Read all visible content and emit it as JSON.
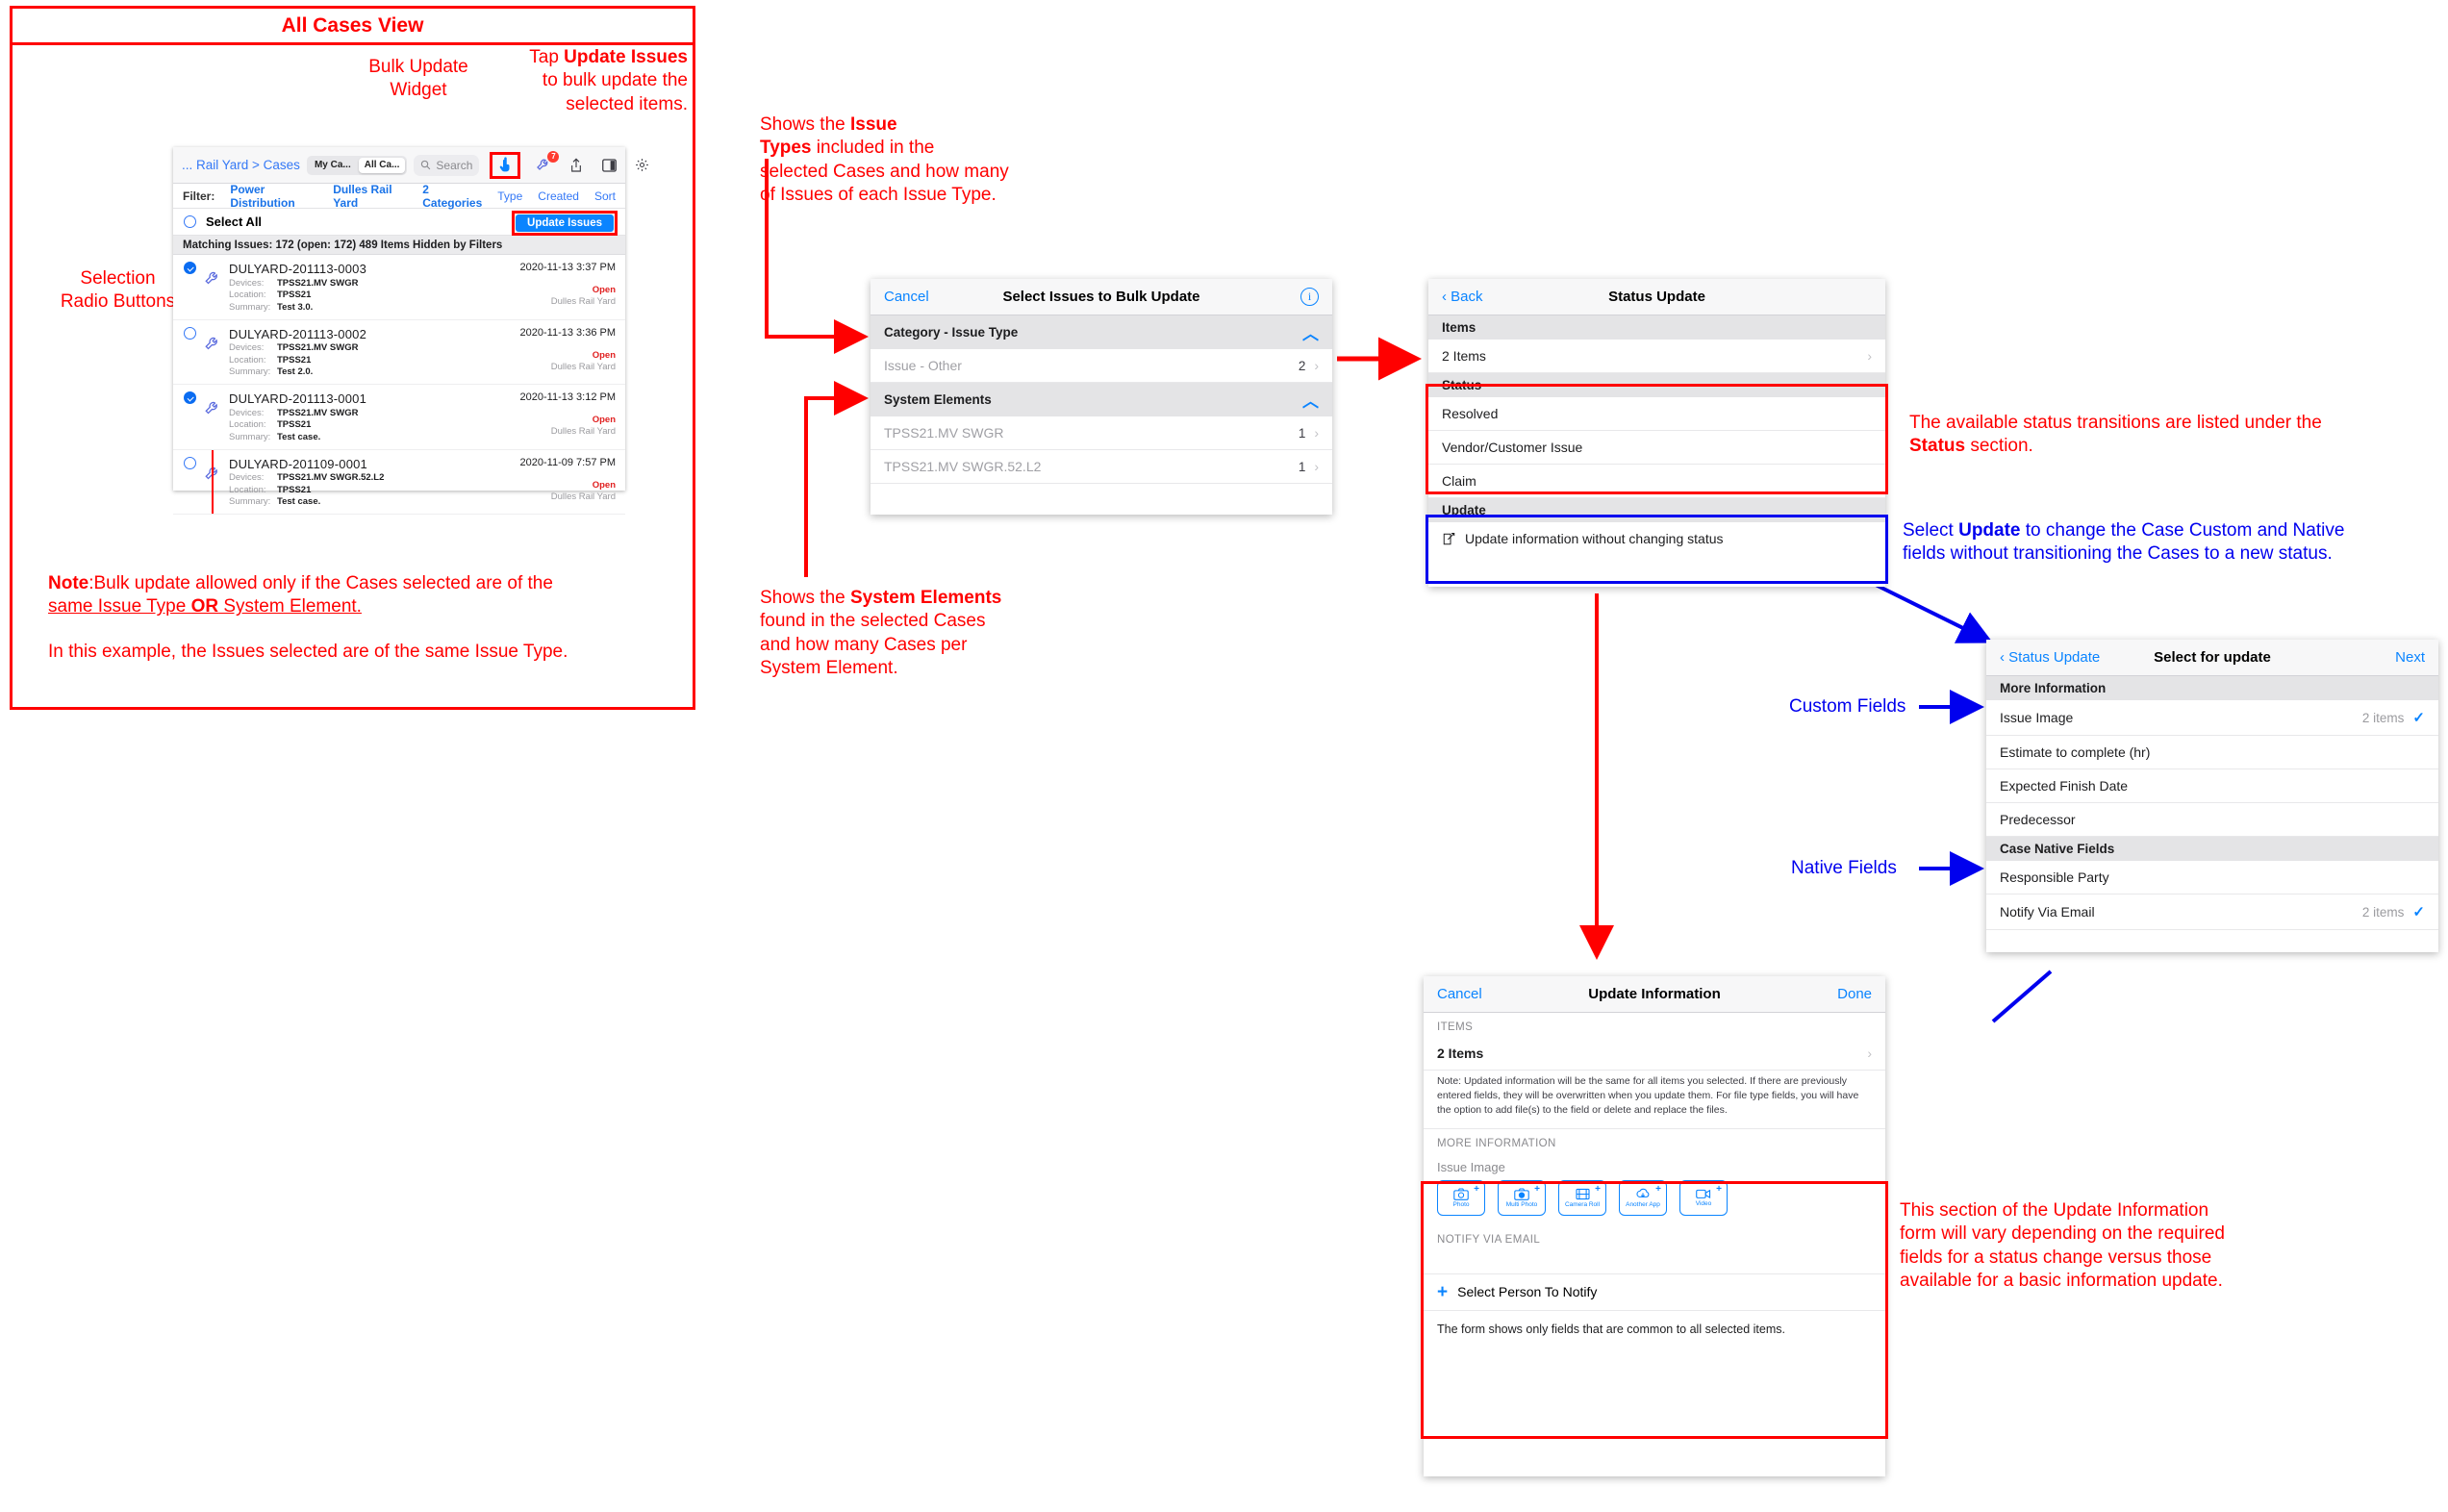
{
  "frame": {
    "title": "All Cases View"
  },
  "annotations": {
    "bulk_update_widget": "Bulk Update\nWidget",
    "tap_update_issues_l1": "Tap ",
    "tap_update_issues_b": "Update Issues",
    "tap_update_issues_l2": "to bulk update the",
    "tap_update_issues_l3": "selected items.",
    "selection_radio": "Selection\nRadio Buttons",
    "note_label": "Note",
    "note_line1": ":Bulk update allowed only if the Cases selected are of the",
    "note_line2a": "same Issue Type ",
    "note_line2b": "OR",
    "note_line2c": " System Element.",
    "note_line3": "In this example, the Issues selected are of the same Issue Type.",
    "issue_types_a": "Shows the ",
    "issue_types_b": "Issue",
    "issue_types_c": "Types",
    "issue_types_d": " included in the",
    "issue_types_e": "selected Cases and how many",
    "issue_types_f": "of Issues of each Issue Type.",
    "system_elements_a": "Shows the ",
    "system_elements_b": "System Elements",
    "system_elements_c": " found in the selected Cases",
    "system_elements_d": "and how many Cases per",
    "system_elements_e": "System Element.",
    "status_transitions_a": "The available status transitions are listed under the",
    "status_transitions_b": "Status",
    "status_transitions_c": " section.",
    "update_select_a": "Select ",
    "update_select_b": "Update",
    "update_select_c": " to change the Case Custom and Native",
    "update_select_d": "fields without transitioning the Cases to a new status.",
    "custom_fields": "Custom Fields",
    "native_fields": "Native Fields",
    "update_info_note_1": "This section of the Update Information",
    "update_info_note_2": "form will vary depending on the required",
    "update_info_note_3": "fields for a status change versus those",
    "update_info_note_4": "available for a basic information update."
  },
  "cases_list": {
    "breadcrumb": "... Rail Yard > Cases",
    "segments": [
      {
        "label": "My Ca...",
        "selected": false
      },
      {
        "label": "All Ca...",
        "selected": true
      }
    ],
    "search_placeholder": "Search",
    "search_icon": "search-icon",
    "toolbar_icons": [
      {
        "name": "bulk-update-hand-icon",
        "badge": ""
      },
      {
        "name": "wrench-icon",
        "badge": "7"
      },
      {
        "name": "share-icon",
        "badge": ""
      },
      {
        "name": "panel-icon",
        "badge": ""
      },
      {
        "name": "gear-icon",
        "badge": ""
      }
    ],
    "filter_label": "Filter:",
    "filters": [
      {
        "label": "Power Distribution",
        "active": true
      },
      {
        "label": "Dulles Rail Yard",
        "active": true
      },
      {
        "label": "2 Categories",
        "active": true
      },
      {
        "label": "Type",
        "active": false
      },
      {
        "label": "Created",
        "active": false
      },
      {
        "label": "Sort",
        "active": false
      }
    ],
    "select_all": "Select All",
    "update_issues_button": "Update Issues",
    "matching_line": "Matching Issues: 172 (open: 172) 489 Items Hidden by Filters",
    "rows": [
      {
        "id": "DULYARD-201113-0003",
        "selected": true,
        "devices_label": "Devices:",
        "devices": "TPSS21.MV SWGR",
        "location_label": "Location:",
        "location": "TPSS21",
        "summary_label": "Summary:",
        "summary": "Test 3.0.",
        "time": "2020-11-13 3:37 PM",
        "status": "Open",
        "site": "Dulles Rail Yard"
      },
      {
        "id": "DULYARD-201113-0002",
        "selected": false,
        "devices_label": "Devices:",
        "devices": "TPSS21.MV SWGR",
        "location_label": "Location:",
        "location": "TPSS21",
        "summary_label": "Summary:",
        "summary": "Test 2.0.",
        "time": "2020-11-13 3:36 PM",
        "status": "Open",
        "site": "Dulles Rail Yard"
      },
      {
        "id": "DULYARD-201113-0001",
        "selected": true,
        "devices_label": "Devices:",
        "devices": "TPSS21.MV SWGR",
        "location_label": "Location:",
        "location": "TPSS21",
        "summary_label": "Summary:",
        "summary": "Test case.",
        "time": "2020-11-13 3:12 PM",
        "status": "Open",
        "site": "Dulles Rail Yard"
      },
      {
        "id": "DULYARD-201109-0001",
        "selected": false,
        "devices_label": "Devices:",
        "devices": "TPSS21.MV SWGR.52.L2",
        "location_label": "Location:",
        "location": "TPSS21",
        "summary_label": "Summary:",
        "summary": "Test case.",
        "time": "2020-11-09 7:57 PM",
        "status": "Open",
        "site": "Dulles Rail Yard"
      }
    ]
  },
  "bulk_sheet": {
    "cancel": "Cancel",
    "title": "Select Issues to Bulk Update",
    "info_icon": "info-icon",
    "groups": [
      {
        "header": "Category - Issue Type",
        "rows": [
          {
            "label": "Issue - Other",
            "count": "2"
          }
        ]
      },
      {
        "header": "System Elements",
        "rows": [
          {
            "label": "TPSS21.MV SWGR",
            "count": "1"
          },
          {
            "label": "TPSS21.MV SWGR.52.L2",
            "count": "1"
          }
        ]
      }
    ]
  },
  "status_sheet": {
    "back": "Back",
    "title": "Status Update",
    "items_header": "Items",
    "items_value": "2 Items",
    "status_header": "Status",
    "status_options": [
      "Resolved",
      "Vendor/Customer Issue",
      "Claim"
    ],
    "update_header": "Update",
    "update_option": "Update information without changing status",
    "update_option_icon": "pencil-square-icon"
  },
  "select_update_sheet": {
    "back": "Status Update",
    "title": "Select for update",
    "next": "Next",
    "sections": [
      {
        "header": "More Information",
        "rows": [
          {
            "label": "Issue Image",
            "count": "2 items",
            "checked": true
          },
          {
            "label": "Estimate to complete (hr)",
            "count": "",
            "checked": false
          },
          {
            "label": "Expected Finish Date",
            "count": "",
            "checked": false
          },
          {
            "label": "Predecessor",
            "count": "",
            "checked": false
          }
        ]
      },
      {
        "header": "Case Native Fields",
        "rows": [
          {
            "label": "Responsible Party",
            "count": "",
            "checked": false
          },
          {
            "label": "Notify Via Email",
            "count": "2 items",
            "checked": true
          }
        ]
      }
    ]
  },
  "update_info_sheet": {
    "cancel": "Cancel",
    "title": "Update Information",
    "done": "Done",
    "items_caption": "ITEMS",
    "items_value": "2 Items",
    "note": "Note: Updated information will be the same for all items you selected. If there are previously entered fields, they will be overwritten when you update them. For file type fields, you will have the option to add file(s) to the field or delete and replace the files.",
    "more_info_caption": "MORE INFORMATION",
    "issue_image_label": "Issue Image",
    "attachments": [
      {
        "caption": "Photo",
        "icon": "camera-icon"
      },
      {
        "caption": "Multi Photo",
        "icon": "multi-camera-icon"
      },
      {
        "caption": "Camera Roll",
        "icon": "film-icon"
      },
      {
        "caption": "Another App",
        "icon": "cloud-download-icon"
      },
      {
        "caption": "Video",
        "icon": "video-icon"
      }
    ],
    "notify_caption": "NOTIFY VIA EMAIL",
    "select_person": "Select Person To Notify",
    "footer": "The form shows only fields that are common to all selected items."
  },
  "colors": {
    "annotation_red": "#ff0000",
    "annotation_blue": "#0000ee",
    "ios_blue": "#0a84ff",
    "status_open": "#e02020",
    "group_header_bg": "#e4e4e6"
  }
}
